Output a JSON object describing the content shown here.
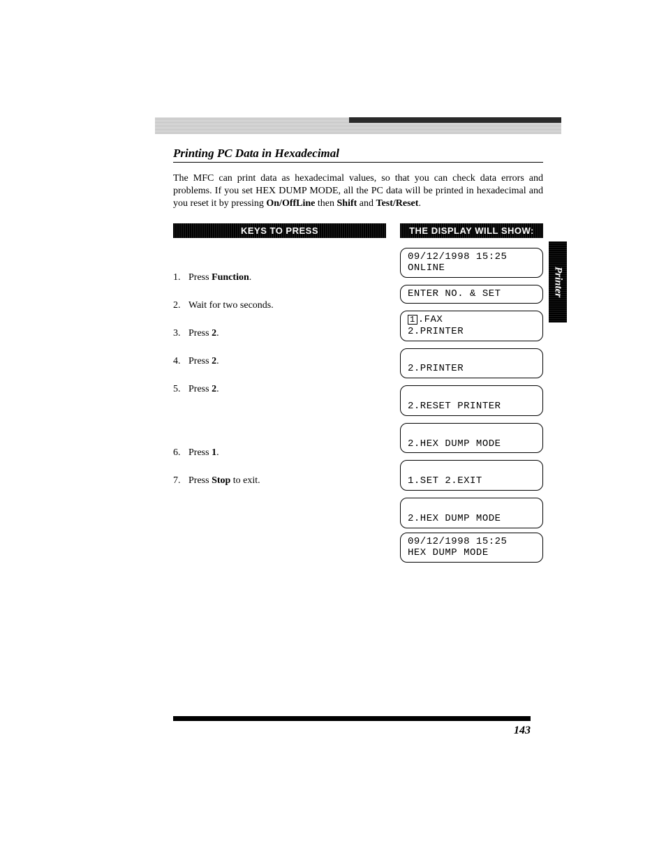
{
  "section_title": "Printing PC Data in Hexadecimal",
  "intro_parts": {
    "p1": "The MFC can print data as hexadecimal values, so that you can check data errors and problems. If you set HEX DUMP MODE, all the PC data will be printed in hexadecimal and you reset it by pressing ",
    "b1": "On/OffLine",
    "p2": " then ",
    "b2": "Shift",
    "p3": " and ",
    "b3": "Test/Reset",
    "p4": "."
  },
  "headers": {
    "left": "KEYS TO PRESS",
    "right": "THE DISPLAY WILL SHOW:"
  },
  "steps": [
    {
      "num": "1.",
      "pre": "Press ",
      "bold": "Function",
      "post": "."
    },
    {
      "num": "2.",
      "pre": "Wait for two seconds.",
      "bold": "",
      "post": ""
    },
    {
      "num": "3.",
      "pre": "Press ",
      "bold": "2",
      "post": "."
    },
    {
      "num": "4.",
      "pre": "Press ",
      "bold": "2",
      "post": "."
    },
    {
      "num": "5.",
      "pre": "Press ",
      "bold": "2",
      "post": "."
    },
    {
      "num": "6.",
      "pre": "Press ",
      "bold": "1",
      "post": "."
    },
    {
      "num": "7.",
      "pre": "Press ",
      "bold": "Stop",
      "post": " to exit."
    }
  ],
  "displays": [
    {
      "lines": [
        "09/12/1998 15:25",
        "ONLINE"
      ]
    },
    {
      "lines": [
        "ENTER NO. & SET"
      ]
    },
    {
      "boxed": "1",
      "after_boxed": ".FAX",
      "line2": "2.PRINTER"
    },
    {
      "lines": [
        "",
        "2.PRINTER"
      ]
    },
    {
      "lines": [
        "",
        "2.RESET PRINTER"
      ]
    },
    {
      "lines": [
        "",
        "2.HEX DUMP MODE"
      ]
    },
    {
      "lines": [
        "",
        "1.SET 2.EXIT"
      ]
    },
    {
      "lines": [
        "",
        "2.HEX DUMP MODE"
      ]
    },
    {
      "lines": [
        "09/12/1998 15:25",
        "HEX DUMP MODE"
      ]
    }
  ],
  "side_tab": "Printer",
  "page_number": "143"
}
